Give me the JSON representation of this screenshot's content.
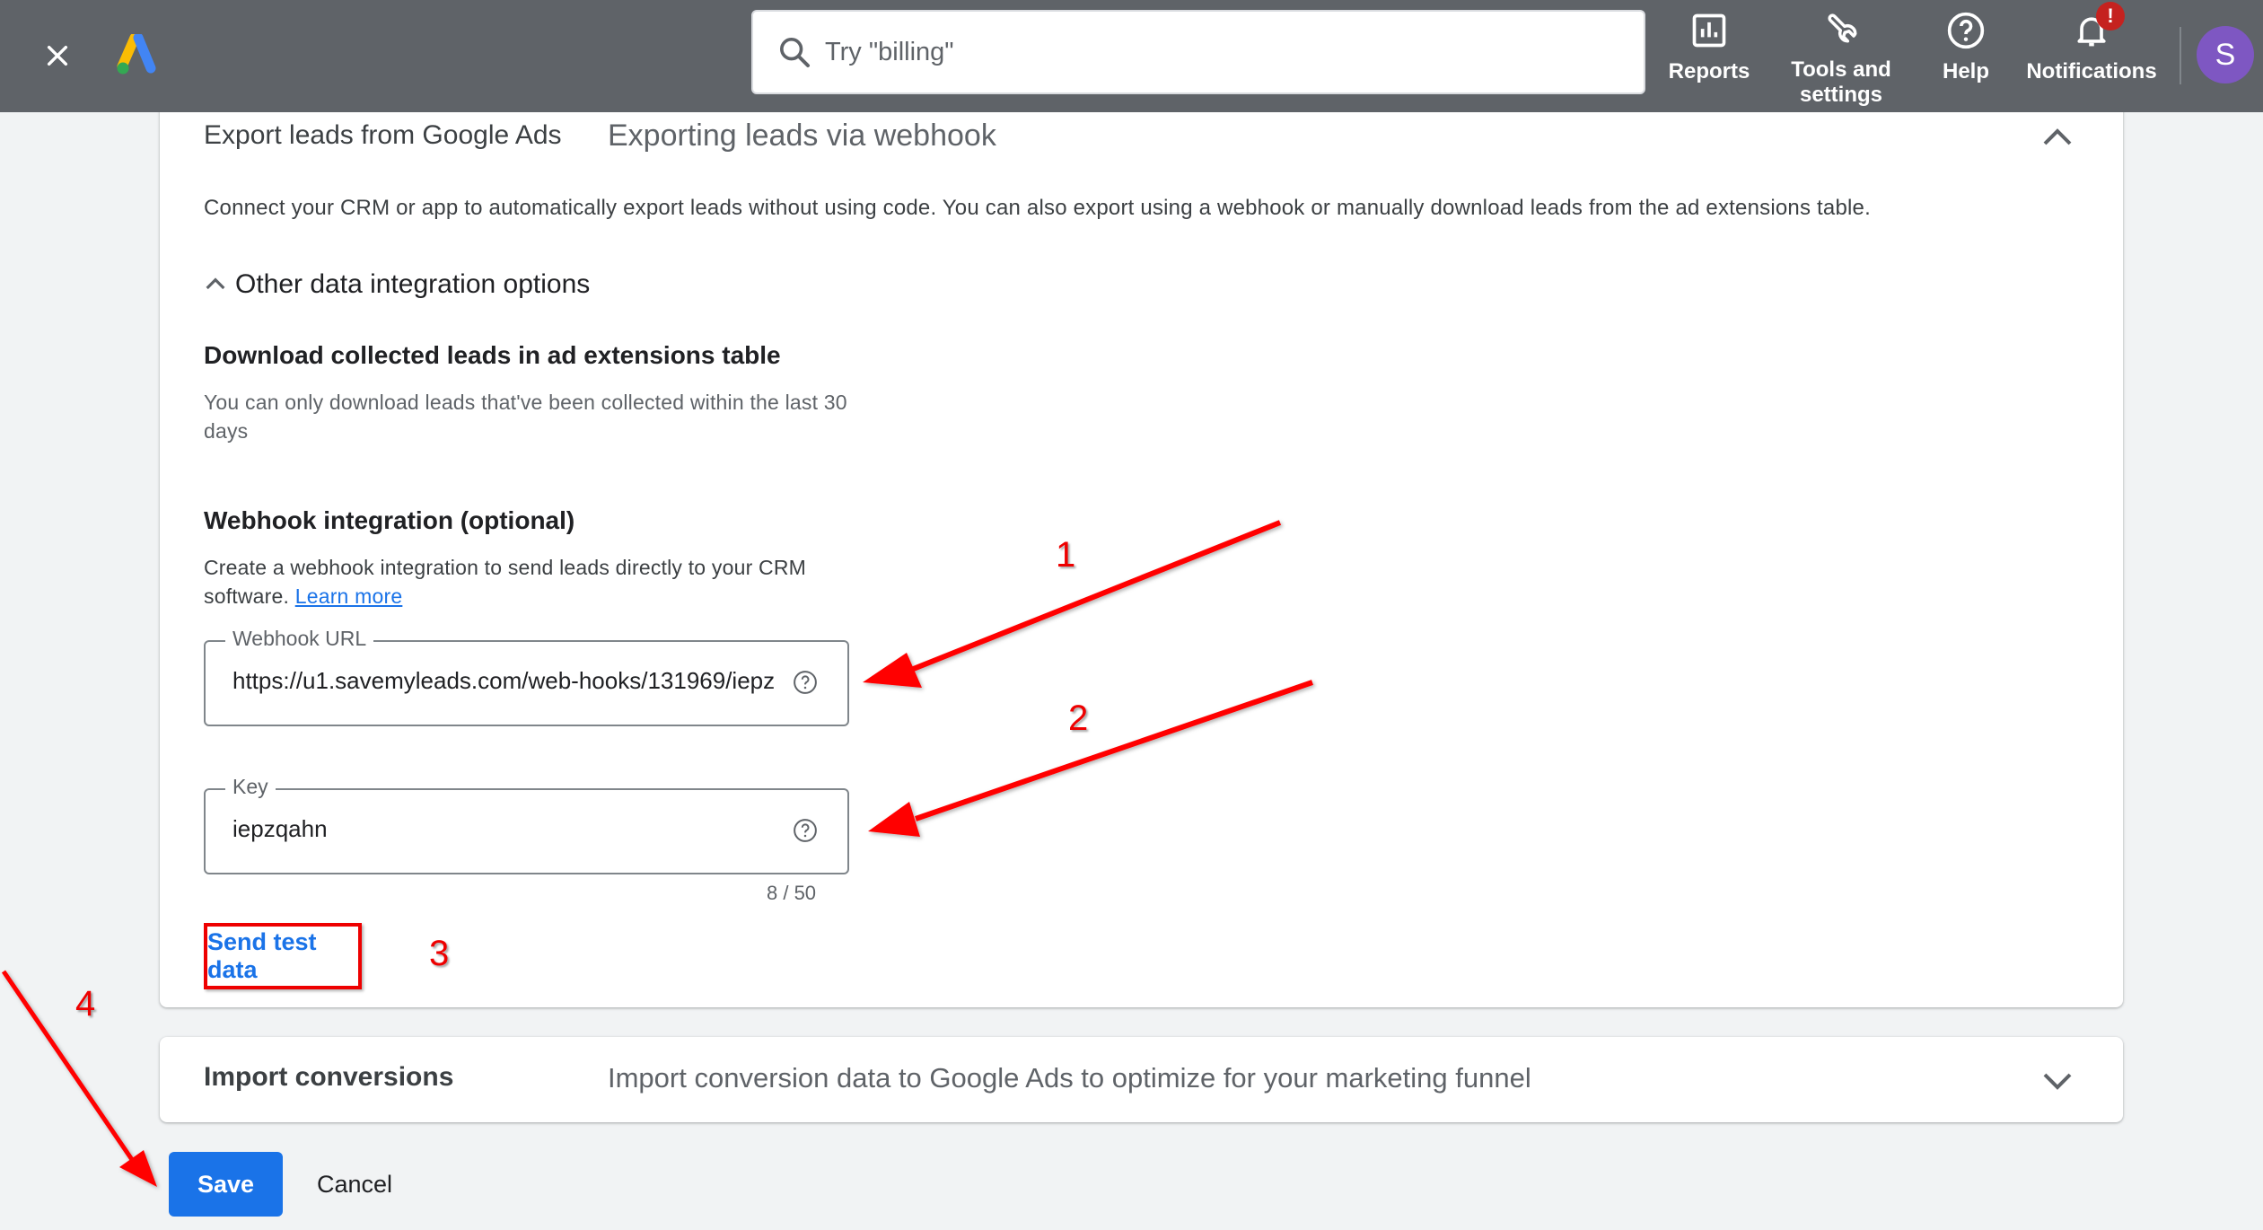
{
  "header": {
    "search_placeholder": "Try \"billing\"",
    "buttons": {
      "reports": "Reports",
      "tools": "Tools and settings",
      "help": "Help",
      "notifications": "Notifications"
    },
    "notification_badge": "!",
    "avatar_initial": "S"
  },
  "card_export": {
    "title": "Export leads from Google Ads",
    "subtitle": "Exporting leads via webhook",
    "description": "Connect your CRM or app to automatically export leads without using code. You can also export using a webhook or manually download leads from the ad extensions table.",
    "other_options_label": "Other data integration options",
    "download_title": "Download collected leads in ad extensions table",
    "download_desc": "You can only download leads that've been collected within the last 30 days",
    "webhook_title": "Webhook integration (optional)",
    "webhook_desc": "Create a webhook integration to send leads directly to your CRM software.",
    "learn_more": "Learn more",
    "webhook_url_label": "Webhook URL",
    "webhook_url_value": "https://u1.savemyleads.com/web-hooks/131969/iepz",
    "key_label": "Key",
    "key_value": "iepzqahn",
    "key_counter": "8 / 50",
    "send_test_label": "Send test data"
  },
  "card_import": {
    "title": "Import conversions",
    "subtitle": "Import conversion data to Google Ads to optimize for your marketing funnel"
  },
  "footer": {
    "save_label": "Save",
    "cancel_label": "Cancel"
  },
  "annotations": {
    "step1": "1",
    "step2": "2",
    "step3": "3",
    "step4": "4",
    "color": "#ff0000"
  },
  "colors": {
    "header_bg": "#5f6368",
    "page_bg": "#f1f3f4",
    "primary": "#1a73e8",
    "avatar": "#7e57c2",
    "badge": "#c5221f"
  }
}
